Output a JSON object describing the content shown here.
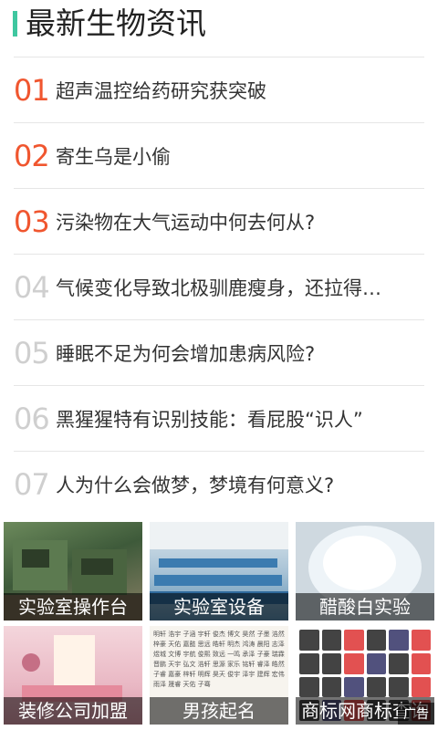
{
  "header": {
    "title": "最新生物资讯"
  },
  "news": [
    {
      "num": "01",
      "title": "超声温控给药研究获突破"
    },
    {
      "num": "02",
      "title": "寄生乌是小偷"
    },
    {
      "num": "03",
      "title": "污染物在大气运动中何去何从?"
    },
    {
      "num": "04",
      "title": "气候变化导致北极驯鹿瘦身，还拉得…"
    },
    {
      "num": "05",
      "title": "睡眠不足为何会增加患病风险?"
    },
    {
      "num": "06",
      "title": "黑猩猩特有识别技能：看屁股“识人”"
    },
    {
      "num": "07",
      "title": "人为什么会做梦，梦境有何意义?"
    }
  ],
  "tiles": [
    {
      "label": "实验室操作台"
    },
    {
      "label": "实验室设备"
    },
    {
      "label": "醋酸白实验"
    },
    {
      "label": "装修公司加盟"
    },
    {
      "label": "男孩起名"
    },
    {
      "label": "商标网商标查询"
    }
  ],
  "ad_badge": "广告",
  "colors": {
    "accent": "#3fc7a0",
    "hot_number": "#f0562f",
    "normal_number": "#cfcfcf"
  }
}
